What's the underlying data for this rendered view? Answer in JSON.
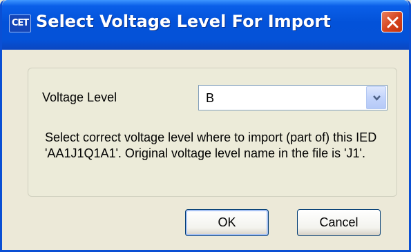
{
  "window": {
    "icon_text": "CET",
    "title": "Select Voltage Level For Import"
  },
  "form": {
    "voltage_label": "Voltage Level",
    "voltage_value": "B",
    "description": "Select correct voltage level where to import (part of) this IED 'AA1J1Q1A1'. Original voltage level name in the file is 'J1'."
  },
  "buttons": {
    "ok_label": "OK",
    "cancel_label": "Cancel"
  },
  "colors": {
    "titlebar": "#0452d8",
    "close": "#d5421c",
    "dialog_bg": "#ece9d8",
    "input_border": "#7f9db9"
  }
}
